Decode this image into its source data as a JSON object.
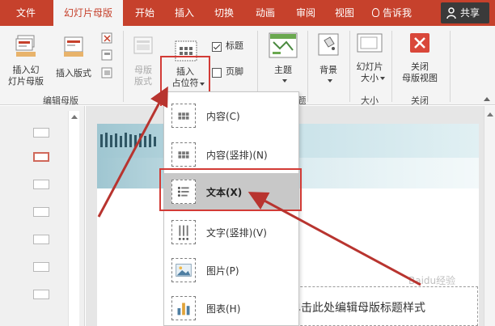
{
  "tabs": [
    {
      "label": "文件"
    },
    {
      "label": "幻灯片母版"
    },
    {
      "label": "开始"
    },
    {
      "label": "插入"
    },
    {
      "label": "切换"
    },
    {
      "label": "动画"
    },
    {
      "label": "审阅"
    },
    {
      "label": "视图"
    }
  ],
  "tell_me": "告诉我",
  "share": "共享",
  "ribbon": {
    "insert_slide_master": "插入幻\n灯片母版",
    "insert_layout": "插入版式",
    "master_layout": "母版\n版式",
    "insert_placeholder": "插入\n占位符",
    "title_check": "标题",
    "footer_check": "页脚",
    "theme": "主题",
    "background": "背景",
    "slide_size": "幻灯片\n大小",
    "close_master_view": "关闭\n母版视图",
    "group_edit_master": "编辑母版",
    "group_size": "大小",
    "group_close": "关闭",
    "group_theme_fragment": "题"
  },
  "menu": {
    "items": [
      {
        "label": "内容(C)",
        "icon": "content-placeholder-icon"
      },
      {
        "label": "内容(竖排)(N)",
        "icon": "vertical-content-placeholder-icon"
      },
      {
        "label": "文本(X)",
        "icon": "text-placeholder-icon",
        "selected": true
      },
      {
        "label": "文字(竖排)(V)",
        "icon": "vertical-text-placeholder-icon"
      },
      {
        "label": "图片(P)",
        "icon": "picture-placeholder-icon"
      },
      {
        "label": "图表(H)",
        "icon": "chart-placeholder-icon"
      }
    ]
  },
  "slide": {
    "title_placeholder": "单击此处编辑母版标题样式"
  },
  "watermark": "Baidu经验",
  "colors": {
    "accent": "#c6412c",
    "highlight": "#d23b36",
    "selected_item": "#c8c8c8"
  }
}
